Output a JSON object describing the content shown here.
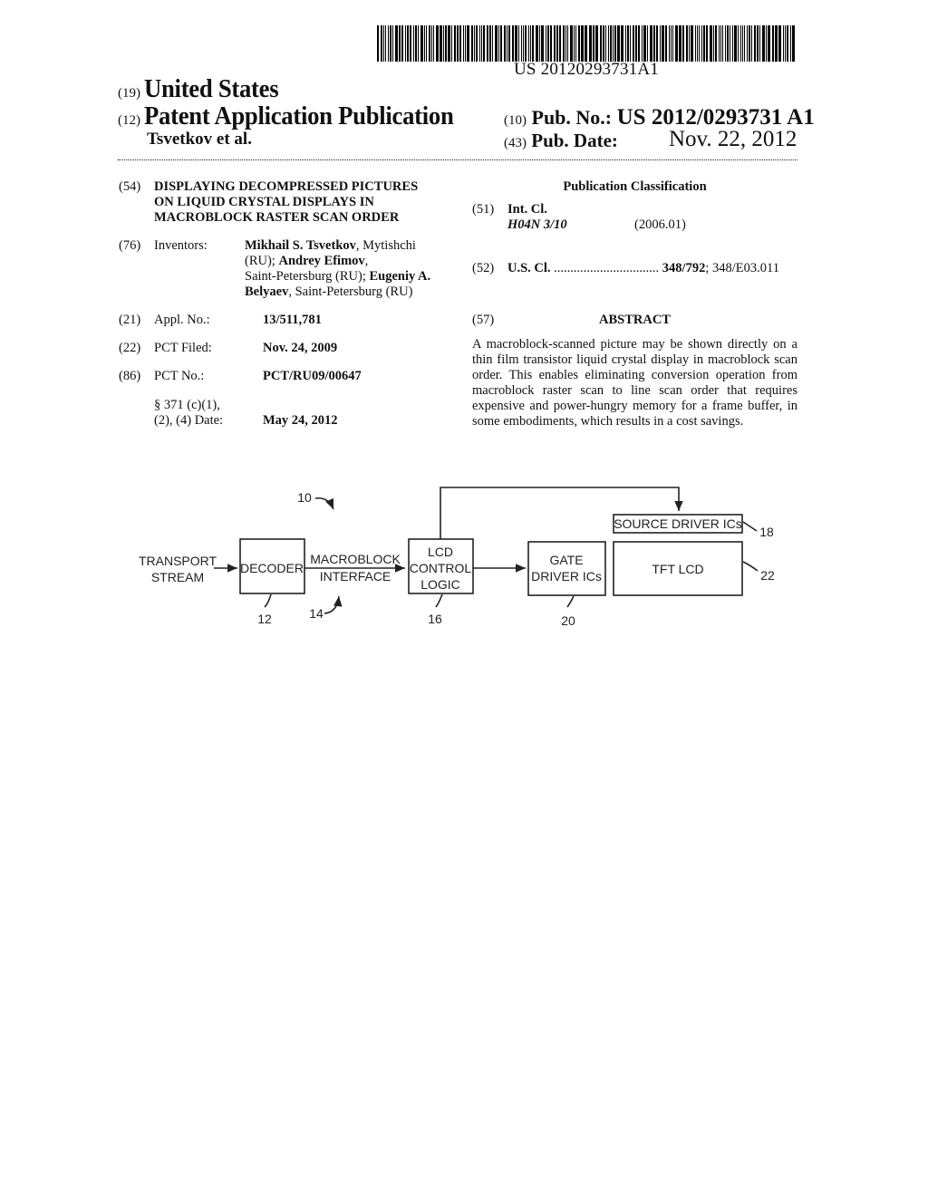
{
  "barcode": {
    "number": "US 20120293731A1"
  },
  "header": {
    "country_tag": "(19)",
    "country": "United States",
    "type_tag": "(12)",
    "type": "Patent Application Publication",
    "authors": "Tsvetkov et al.",
    "pub_no_tag": "(10)",
    "pub_no_label": "Pub. No.:",
    "pub_no": "US 2012/0293731 A1",
    "pub_date_tag": "(43)",
    "pub_date_label": "Pub. Date:",
    "pub_date": "Nov. 22, 2012"
  },
  "left": {
    "title": {
      "tag": "(54)",
      "lines": [
        "DISPLAYING DECOMPRESSED PICTURES",
        "ON LIQUID CRYSTAL DISPLAYS IN",
        "MACROBLOCK RASTER SCAN ORDER"
      ]
    },
    "inventors": {
      "tag": "(76)",
      "label": "Inventors:",
      "lines": [
        [
          {
            "t": "Mikhail S. Tsvetkov",
            "b": true
          },
          {
            "t": ", Mytishchi",
            "b": false
          }
        ],
        [
          {
            "t": "(RU); ",
            "b": false
          },
          {
            "t": "Andrey Efimov",
            "b": true
          },
          {
            "t": ",",
            "b": false
          }
        ],
        [
          {
            "t": "Saint-Petersburg (RU); ",
            "b": false
          },
          {
            "t": "Eugeniy A.",
            "b": true
          }
        ],
        [
          {
            "t": "Belyaev",
            "b": true
          },
          {
            "t": ", Saint-Petersburg (RU)",
            "b": false
          }
        ]
      ]
    },
    "appl_no": {
      "tag": "(21)",
      "label": "Appl. No.:",
      "value": "13/511,781"
    },
    "pct_filed": {
      "tag": "(22)",
      "label": "PCT Filed:",
      "value": "Nov. 24, 2009"
    },
    "pct_no": {
      "tag": "(86)",
      "label": "PCT No.:",
      "value": "PCT/RU09/00647"
    },
    "section371": {
      "label_line1": "§ 371 (c)(1),",
      "label_line2": "(2), (4) Date:",
      "value": "May 24, 2012"
    }
  },
  "right": {
    "classification_heading": "Publication Classification",
    "int_cl": {
      "tag": "(51)",
      "label": "Int. Cl.",
      "code": "H04N 3/10",
      "version": "(2006.01)"
    },
    "us_cl": {
      "tag": "(52)",
      "label": "U.S. Cl.",
      "dots": "................................",
      "primary": "348/792",
      "secondary": "; 348/E03.011"
    },
    "abstract": {
      "tag": "(57)",
      "heading": "ABSTRACT",
      "text": "A macroblock-scanned picture may be shown directly on a thin film transistor liquid crystal display in macroblock scan order. This enables eliminating conversion operation from macroblock raster scan to line scan order that requires expensive and power-hungry memory for a frame buffer, in some embodiments, which results in a cost savings."
    }
  },
  "figure": {
    "system_ref": "10",
    "input_label": [
      "TRANSPORT",
      "STREAM"
    ],
    "decoder": {
      "label": "DECODER",
      "ref": "12"
    },
    "interface": {
      "label": [
        "MACROBLOCK",
        "INTERFACE"
      ],
      "ref": "14"
    },
    "lcd_control": {
      "label": [
        "LCD",
        "CONTROL",
        "LOGIC"
      ],
      "ref": "16"
    },
    "source_driver": {
      "label": "SOURCE DRIVER ICs",
      "ref": "18"
    },
    "gate_driver": {
      "label": [
        "GATE",
        "DRIVER ICs"
      ],
      "ref": "20"
    },
    "tft_lcd": {
      "label": "TFT LCD",
      "ref": "22"
    }
  }
}
